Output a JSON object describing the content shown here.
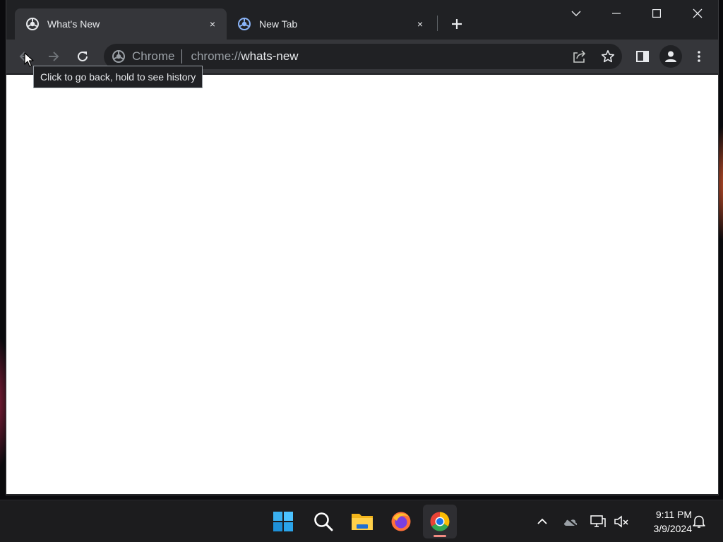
{
  "browser": {
    "tabs": [
      {
        "title": "What's New",
        "active": true,
        "close_label": "×"
      },
      {
        "title": "New Tab",
        "active": false,
        "close_label": "×"
      }
    ],
    "omnibox": {
      "chip_label": "Chrome",
      "url_scheme": "chrome://",
      "url_host": "whats-new"
    },
    "tooltip": "Click to go back, hold to see history"
  },
  "taskbar": {
    "apps": [
      "start-icon",
      "search-icon",
      "file-explorer-icon",
      "firefox-icon",
      "chrome-icon"
    ],
    "clock": {
      "time": "9:11 PM",
      "date": "3/9/2024"
    }
  },
  "colors": {
    "tab_strip": "#202124",
    "toolbar": "#35363a",
    "page_background": "#ffffff",
    "taskbar": "#1c1c1e"
  }
}
